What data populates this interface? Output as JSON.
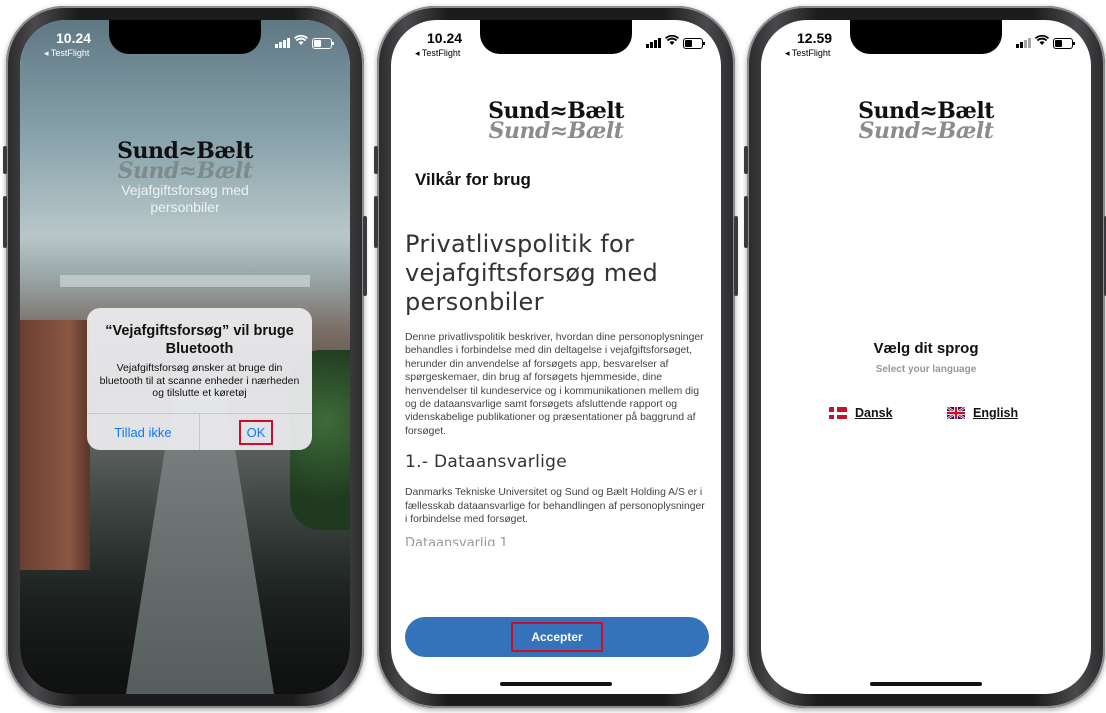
{
  "screens": [
    {
      "status": {
        "time": "10.24",
        "back_label": "◂ TestFlight"
      },
      "brand": {
        "line1": "Sund≈Bælt",
        "line2": "Sund≈Bælt"
      },
      "tagline": [
        "Vejafgiftsforsøg med",
        "personbiler"
      ],
      "alert": {
        "title": "“Vejafgiftsforsøg” vil bruge Bluetooth",
        "message": "Vejafgiftsforsøg ønsker at bruge din bluetooth til at scanne enheder i nærheden og tilslutte et køretøj",
        "deny_label": "Tillad ikke",
        "ok_label": "OK"
      }
    },
    {
      "status": {
        "time": "10.24",
        "back_label": "◂ TestFlight"
      },
      "brand": {
        "line1": "Sund≈Bælt",
        "line2": "Sund≈Bælt"
      },
      "heading": "Vilkår for brug",
      "policy_title": "Privatlivspolitik for vejafgiftsforsøg med personbiler",
      "policy_intro": "Denne privatlivspolitik beskriver, hvordan dine personoplysninger behandles i forbindelse med din deltagelse i vejafgiftsforsøget, herunder din anvendelse af forsøgets app, besvarelser af spørgeskemaer, din brug af forsøgets hjemmeside, dine henvendelser til kundeservice og i kommunikationen mellem dig og de dataansvarlige samt forsøgets afsluttende rapport og videnskabelige publikationer og præsentationer på baggrund af forsøget.",
      "section1_title": "1.- Dataansvarlige",
      "section1_text": "Danmarks Tekniske Universitet og Sund og Bælt Holding A/S er i fællesskab dataansvarlige for behandlingen af personoplysninger i forbindelse med forsøget.",
      "section_cut": "Dataansvarlig 1",
      "accept_label": "Accepter"
    },
    {
      "status": {
        "time": "12.59",
        "back_label": "◂ TestFlight"
      },
      "brand": {
        "line1": "Sund≈Bælt",
        "line2": "Sund≈Bælt"
      },
      "title": "Vælg dit sprog",
      "subtitle": "Select your language",
      "languages": [
        {
          "label": "Dansk",
          "flag": "flag-denmark-icon"
        },
        {
          "label": "English",
          "flag": "flag-uk-icon"
        }
      ]
    }
  ],
  "colors": {
    "accent_blue": "#3472b9",
    "ios_link": "#0a7aff",
    "highlight_red": "#c8102e"
  }
}
